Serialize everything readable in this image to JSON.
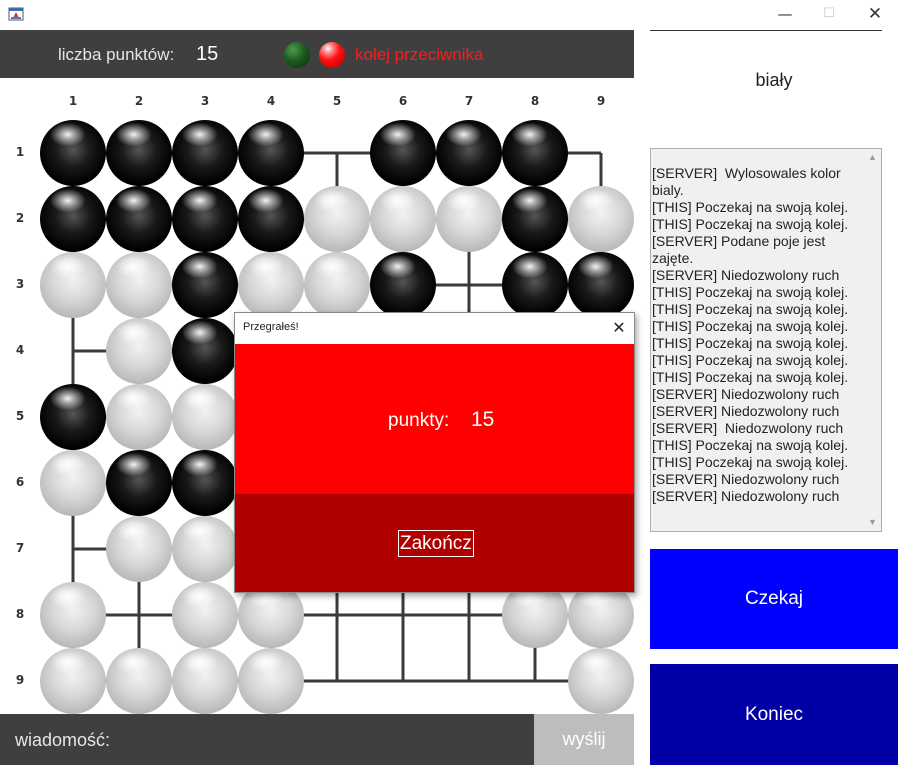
{
  "window": {
    "minimize_glyph": "—",
    "maximize_glyph": "☐",
    "close_glyph": "✕"
  },
  "status": {
    "score_label": "liczba punktów:",
    "score_value": "15",
    "turn_text": "kolej przeciwnika",
    "indicator_green": "#1d5c1d",
    "indicator_red": "#ff1010"
  },
  "board": {
    "columns": [
      "1",
      "2",
      "3",
      "4",
      "5",
      "6",
      "7",
      "8",
      "9"
    ],
    "rows": [
      "1",
      "2",
      "3",
      "4",
      "5",
      "6",
      "7",
      "8",
      "9"
    ],
    "legend": "B = black stone, W = white stone, . = empty intersection",
    "grid": [
      "BBBB.BBB.",
      "BBBBWWWBW",
      "WWBWWB.BB",
      ".WB......",
      "BWW......",
      "WBB......",
      ".WW......",
      "W.WW...WW",
      "WWWW....W"
    ]
  },
  "message": {
    "label": "wiadomość:",
    "input_value": "",
    "send_label": "wyślij"
  },
  "panel": {
    "player_color": "biały",
    "log": [
      "[SERVER]  Wylosowales kolor bialy.",
      "[THIS] Poczekaj na swoją kolej.",
      "[THIS] Poczekaj na swoją kolej.",
      "[SERVER] Podane poje jest zajęte.",
      "[SERVER] Niedozwolony ruch",
      "[THIS] Poczekaj na swoją kolej.",
      "[THIS] Poczekaj na swoją kolej.",
      "[THIS] Poczekaj na swoją kolej.",
      "[THIS] Poczekaj na swoją kolej.",
      "[THIS] Poczekaj na swoją kolej.",
      "[THIS] Poczekaj na swoją kolej.",
      "[SERVER] Niedozwolony ruch",
      "[SERVER] Niedozwolony ruch",
      "[SERVER]  Niedozwolony ruch",
      "[THIS] Poczekaj na swoją kolej.",
      "[THIS] Poczekaj na swoją kolej.",
      "[SERVER] Niedozwolony ruch",
      "[SERVER] Niedozwolony ruch"
    ],
    "wait_label": "Czekaj",
    "end_label": "Koniec",
    "wait_color": "#0000ff",
    "end_color": "#0000a6"
  },
  "dialog": {
    "title": "Przegrałeś!",
    "close_glyph": "✕",
    "points_label": "punkty:",
    "points_value": "15",
    "finish_label": "Zakończ",
    "top_color": "#ff0000",
    "bottom_color": "#b00000"
  }
}
